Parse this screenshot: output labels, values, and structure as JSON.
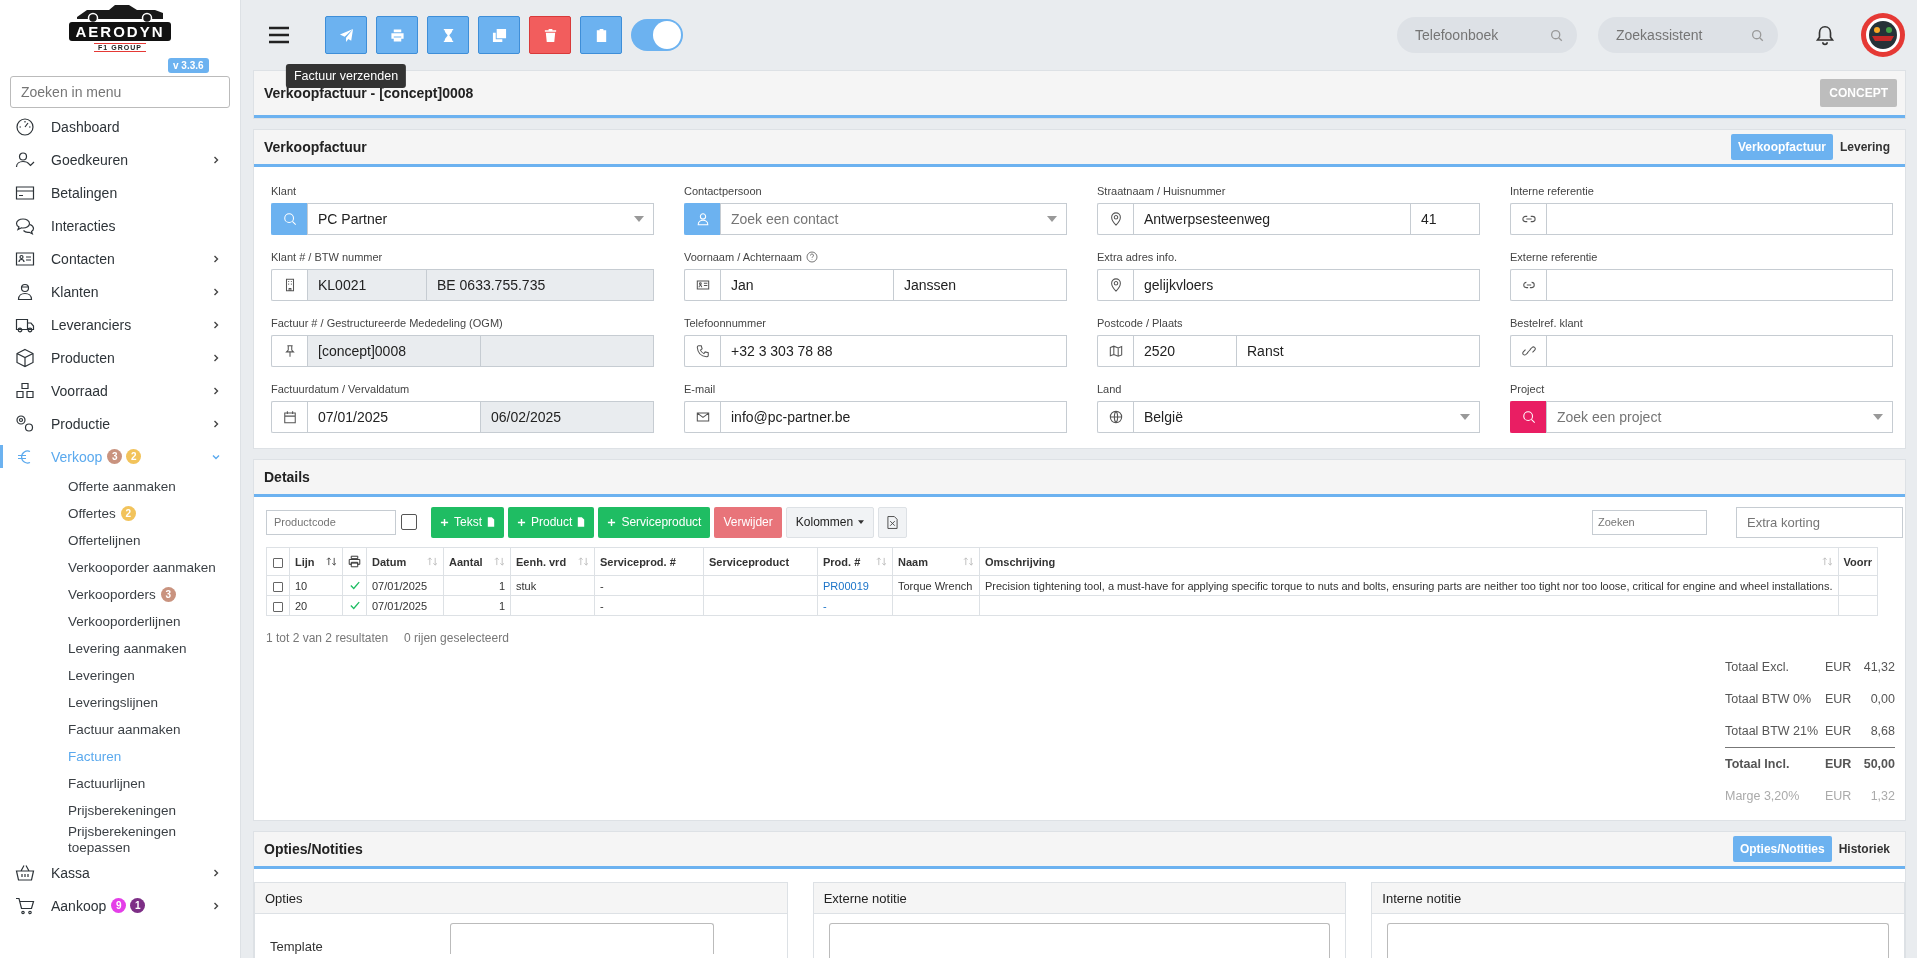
{
  "sidebar": {
    "logo": {
      "name": "AERODYN",
      "tagline": "F1 GROUP"
    },
    "version": "v 3.3.6",
    "search": {
      "placeholder": "Zoeken in menu"
    },
    "items": [
      {
        "label": "Dashboard",
        "expandable": false,
        "selected": false
      },
      {
        "label": "Goedkeuren",
        "expandable": true,
        "expanded": false,
        "selected": false
      },
      {
        "label": "Betalingen",
        "expandable": false,
        "selected": false
      },
      {
        "label": "Interacties",
        "expandable": false,
        "selected": false
      },
      {
        "label": "Contacten",
        "expandable": true,
        "expanded": false,
        "selected": false
      },
      {
        "label": "Klanten",
        "expandable": true,
        "expanded": false,
        "selected": false
      },
      {
        "label": "Leveranciers",
        "expandable": true,
        "expanded": false,
        "selected": false
      },
      {
        "label": "Producten",
        "expandable": true,
        "expanded": false,
        "selected": false
      },
      {
        "label": "Voorraad",
        "expandable": true,
        "expanded": false,
        "selected": false
      },
      {
        "label": "Productie",
        "expandable": true,
        "expanded": false,
        "selected": false
      },
      {
        "label": "Verkoop",
        "expandable": true,
        "expanded": true,
        "selected": true,
        "badges": [
          {
            "text": "3",
            "color": "#c9937f"
          },
          {
            "text": "2",
            "color": "#f2c35b"
          }
        ],
        "children": [
          {
            "label": "Offerte aanmaken",
            "selected": false
          },
          {
            "label": "Offertes",
            "selected": false,
            "badges": [
              {
                "text": "2",
                "color": "#f2c35b"
              }
            ]
          },
          {
            "label": "Offertelijnen",
            "selected": false
          },
          {
            "label": "Verkooporder aanmaken",
            "selected": false
          },
          {
            "label": "Verkooporders",
            "selected": false,
            "badges": [
              {
                "text": "3",
                "color": "#c9937f"
              }
            ]
          },
          {
            "label": "Verkooporderlijnen",
            "selected": false
          },
          {
            "label": "Levering aanmaken",
            "selected": false
          },
          {
            "label": "Leveringen",
            "selected": false
          },
          {
            "label": "Leveringslijnen",
            "selected": false
          },
          {
            "label": "Factuur aanmaken",
            "selected": false
          },
          {
            "label": "Facturen",
            "selected": true
          },
          {
            "label": "Factuurlijnen",
            "selected": false
          },
          {
            "label": "Prijsberekeningen",
            "selected": false
          },
          {
            "label": "Prijsberekeningen toepassen",
            "selected": false
          }
        ]
      },
      {
        "label": "Kassa",
        "expandable": true,
        "expanded": false,
        "selected": false
      },
      {
        "label": "Aankoop",
        "expandable": true,
        "expanded": false,
        "selected": false,
        "badges": [
          {
            "text": "9",
            "color": "#e43fe8"
          },
          {
            "text": "1",
            "color": "#7d2f86"
          }
        ]
      }
    ]
  },
  "toolbar": {
    "buttons": [
      {
        "kind": "primary"
      },
      {
        "kind": "primary"
      },
      {
        "kind": "primary"
      },
      {
        "kind": "primary"
      },
      {
        "kind": "danger"
      },
      {
        "kind": "primary"
      }
    ],
    "toggle": {
      "on": true
    },
    "tooltip": "Factuur verzenden",
    "searches": [
      {
        "placeholder": "Telefoonboek"
      },
      {
        "placeholder": "Zoekassistent"
      }
    ]
  },
  "header": {
    "title": "Verkoopfactuur - [concept]0008",
    "status": "CONCEPT"
  },
  "invoice": {
    "title": "Verkoopfactuur",
    "tabs": [
      {
        "label": "Verkoopfactuur",
        "selected": true
      },
      {
        "label": "Levering",
        "selected": false
      }
    ],
    "fields": [
      {
        "label": "Klant",
        "kind": "lookup",
        "parts": [
          {
            "value": "PC Partner",
            "readonly": false
          }
        ]
      },
      {
        "label": "Contactpersoon",
        "kind": "lookup",
        "parts": [
          {
            "placeholder": "Zoek een contact",
            "readonly": false
          }
        ]
      },
      {
        "label": "Straatnaam / Huisnummer",
        "kind": "text",
        "parts": [
          {
            "value": "Antwerpsesteenweg",
            "readonly": false
          },
          {
            "value": "41",
            "readonly": false
          }
        ]
      },
      {
        "label": "Interne referentie",
        "kind": "text",
        "parts": [
          {
            "readonly": false
          }
        ]
      },
      {
        "label": "Klant # / BTW nummer",
        "kind": "text",
        "parts": [
          {
            "value": "KL0021",
            "readonly": true
          },
          {
            "value": "BE 0633.755.735",
            "readonly": true
          }
        ]
      },
      {
        "label": "Voornaam / Achternaam",
        "help": true,
        "kind": "text",
        "parts": [
          {
            "value": "Jan",
            "readonly": false
          },
          {
            "value": "Janssen",
            "readonly": false
          }
        ]
      },
      {
        "label": "Extra adres info.",
        "kind": "text",
        "parts": [
          {
            "value": "gelijkvloers",
            "readonly": false
          }
        ]
      },
      {
        "label": "Externe referentie",
        "kind": "text",
        "parts": [
          {
            "readonly": false
          }
        ]
      },
      {
        "label": "Factuur # / Gestructureerde Mededeling (OGM)",
        "kind": "text",
        "parts": [
          {
            "value": "[concept]0008",
            "readonly": true
          },
          {
            "readonly": true
          }
        ]
      },
      {
        "label": "Telefoonnummer",
        "kind": "text",
        "parts": [
          {
            "value": "+32 3 303 78 88",
            "readonly": false
          }
        ]
      },
      {
        "label": "Postcode / Plaats",
        "kind": "text",
        "parts": [
          {
            "value": "2520",
            "readonly": false
          },
          {
            "value": "Ranst",
            "readonly": false
          }
        ]
      },
      {
        "label": "Bestelref. klant",
        "kind": "text",
        "parts": [
          {
            "readonly": false
          }
        ]
      },
      {
        "label": "Factuurdatum / Vervaldatum",
        "kind": "text",
        "parts": [
          {
            "value": "07/01/2025",
            "readonly": false
          },
          {
            "value": "06/02/2025",
            "readonly": true
          }
        ]
      },
      {
        "label": "E-mail",
        "kind": "text",
        "parts": [
          {
            "value": "info@pc-partner.be",
            "readonly": false
          }
        ]
      },
      {
        "label": "Land",
        "kind": "select",
        "parts": [
          {
            "value": "België",
            "readonly": false
          }
        ]
      },
      {
        "label": "Project",
        "kind": "project",
        "parts": [
          {
            "placeholder": "Zoek een project",
            "readonly": false
          }
        ]
      }
    ]
  },
  "details": {
    "title": "Details",
    "productcode": {
      "placeholder": "Productcode"
    },
    "select_all": {
      "checked": false
    },
    "buttons": [
      {
        "label": "Tekst",
        "kind": "success",
        "icon": true,
        "plus": true
      },
      {
        "label": "Product",
        "kind": "success",
        "icon": true,
        "plus": true
      },
      {
        "label": "Serviceproduct",
        "kind": "success",
        "icon": false,
        "plus": true
      },
      {
        "label": "Verwijder",
        "kind": "danger",
        "icon": false,
        "plus": false
      },
      {
        "label": "Kolommen",
        "kind": "dropdown",
        "icon": false,
        "plus": false
      }
    ],
    "search": {
      "placeholder": "Zoeken"
    },
    "discount": {
      "placeholder": "Extra korting"
    },
    "table": {
      "columns": [
        {
          "kind": "checkbox",
          "checked": false
        },
        {
          "label": "Lijn",
          "kind": "text",
          "sortable": true,
          "sorted": true
        },
        {
          "kind": "print"
        },
        {
          "label": "Datum",
          "kind": "text",
          "sortable": true,
          "sorted": false
        },
        {
          "label": "Aantal",
          "kind": "number",
          "sortable": true,
          "sorted": false
        },
        {
          "label": "Eenh. vrd",
          "kind": "text",
          "sortable": true,
          "sorted": false
        },
        {
          "label": "Serviceprod. #",
          "kind": "text",
          "sortable": false
        },
        {
          "label": "Serviceproduct",
          "kind": "text",
          "sortable": false
        },
        {
          "label": "Prod. #",
          "kind": "link",
          "sortable": true,
          "sorted": false
        },
        {
          "label": "Naam",
          "kind": "text",
          "sortable": true,
          "sorted": false
        },
        {
          "label": "Omschrijving",
          "kind": "text",
          "sortable": true,
          "sorted": false
        },
        {
          "label": "Voorr",
          "kind": "text"
        }
      ],
      "rows": [
        {
          "checked": false,
          "printed": true,
          "cells": [
            null,
            "10",
            null,
            "07/01/2025",
            "1",
            "stuk",
            "-",
            null,
            "PR00019",
            "Torque Wrench",
            "Precision tightening tool, a must-have for applying specific torque to nuts and bolts, ensuring parts are neither too tight nor too loose, critical for engine and wheel installations.",
            null
          ]
        },
        {
          "checked": false,
          "printed": true,
          "cells": [
            null,
            "20",
            null,
            "07/01/2025",
            "1",
            null,
            "-",
            null,
            "-",
            null,
            null,
            null
          ]
        }
      ]
    },
    "summary": "1 tot 2 van 2 resultaten",
    "selection": "0 rijen geselecteerd",
    "totals": [
      {
        "label": "Totaal Excl.",
        "currency": "EUR",
        "amount": "41,32",
        "kind": "normal"
      },
      {
        "label": "Totaal BTW 0%",
        "currency": "EUR",
        "amount": "0,00",
        "kind": "normal"
      },
      {
        "label": "Totaal BTW 21%",
        "currency": "EUR",
        "amount": "8,68",
        "kind": "normal"
      },
      {
        "label": "Totaal Incl.",
        "currency": "EUR",
        "amount": "50,00",
        "kind": "total"
      },
      {
        "label": "Marge 3,20%",
        "currency": "EUR",
        "amount": "1,32",
        "kind": "muted"
      }
    ]
  },
  "notes": {
    "title": "Opties/Notities",
    "tabs": [
      {
        "label": "Opties/Notities",
        "selected": true
      },
      {
        "label": "Historiek",
        "selected": false
      }
    ],
    "panels": [
      {
        "title": "Opties",
        "kind": "options",
        "field_label": "Template"
      },
      {
        "title": "Externe notitie",
        "kind": "note"
      },
      {
        "title": "Interne notitie",
        "kind": "note"
      }
    ]
  }
}
